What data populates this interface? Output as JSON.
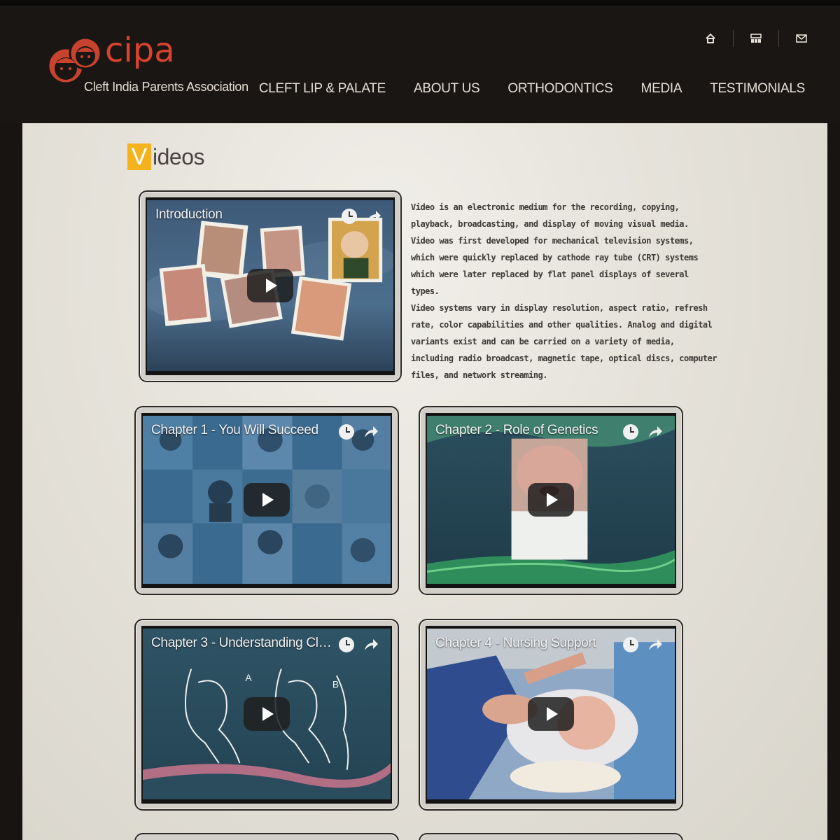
{
  "brand": {
    "logo_word": "cipa",
    "tagline": "Cleft India Parents Association",
    "accent_color": "#d9432e"
  },
  "utility_icons": [
    "home-icon",
    "sitemap-icon",
    "mail-icon"
  ],
  "nav": {
    "items": [
      {
        "label": "CLEFT LIP & PALATE"
      },
      {
        "label": "ABOUT US"
      },
      {
        "label": "ORTHODONTICS"
      },
      {
        "label": "MEDIA"
      },
      {
        "label": "TESTIMONIALS"
      }
    ]
  },
  "page": {
    "title_initial": "V",
    "title_rest": "ideos",
    "title_accent": "#f4b21c"
  },
  "description": {
    "paragraphs": [
      "Video is an electronic medium for the recording, copying, playback, broadcasting, and display of moving visual media.",
      "Video was first developed for mechanical television systems, which were quickly replaced by cathode ray tube (CRT) systems which were later replaced by flat panel displays of several types.",
      "Video systems vary in display resolution, aspect ratio, refresh rate, color capabilities and other qualities. Analog and digital variants exist and can be carried on a variety of media, including radio broadcast, magnetic tape, optical discs, computer files, and network streaming."
    ]
  },
  "videos": [
    {
      "title": "Introduction"
    },
    {
      "title": "Chapter 1 - You Will Succeed"
    },
    {
      "title": "Chapter 2 - Role of Genetics"
    },
    {
      "title": "Chapter 3 - Understanding Cleft..."
    },
    {
      "title": "Chapter 4 - Nursing Support"
    }
  ]
}
